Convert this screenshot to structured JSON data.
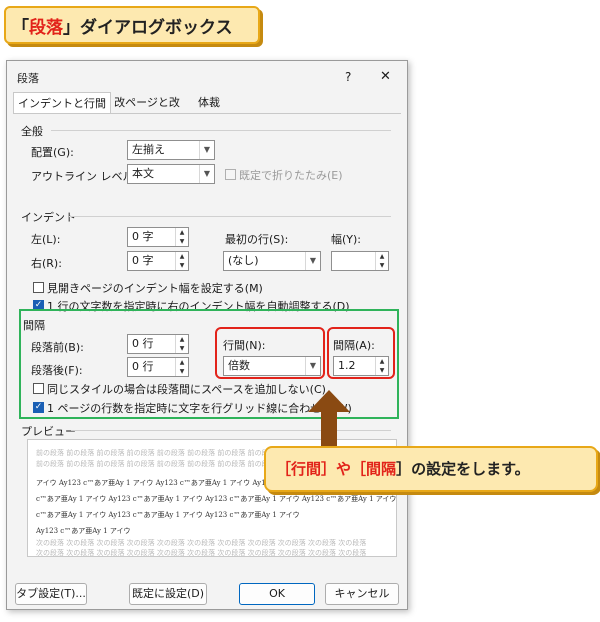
{
  "banner": {
    "prefix": "「",
    "highlight": "段落",
    "suffix": "」ダイアログボックス"
  },
  "dialog": {
    "title": "段落",
    "help": "?",
    "close": "✕",
    "tabs": [
      "インデントと行間隔",
      "改ページと改行",
      "体裁"
    ],
    "general": {
      "header": "全般",
      "alignment_label": "配置(G):",
      "alignment_value": "左揃え",
      "outline_label": "アウトライン レベル(O):",
      "outline_value": "本文",
      "collapsed_label": "既定で折りたたみ(E)"
    },
    "indent": {
      "header": "インデント",
      "left_label": "左(L):",
      "left_value": "0 字",
      "right_label": "右(R):",
      "right_value": "0 字",
      "first_line_label": "最初の行(S):",
      "first_line_value": "(なし)",
      "width_label": "幅(Y):",
      "width_value": "",
      "mirror_label": "見開きページのインデント幅を設定する(M)",
      "auto_adjust_label": "1 行の文字数を指定時に右のインデント幅を自動調整する(D)"
    },
    "spacing": {
      "header": "間隔",
      "before_label": "段落前(B):",
      "before_value": "0 行",
      "after_label": "段落後(F):",
      "after_value": "0 行",
      "line_spacing_label": "行間(N):",
      "line_spacing_value": "倍数",
      "at_label": "間隔(A):",
      "at_value": "1.2",
      "no_space_label": "同じスタイルの場合は段落間にスペースを追加しない(C)",
      "snap_grid_label": "1 ページの行数を指定時に文字を行グリッド線に合わせる(W)"
    },
    "preview": {
      "header": "プレビュー",
      "prev_para": "前の段落 前の段落 前の段落 前の段落 前の段落 前の段落 前の段落 前の段落 前の段落 前の段落 前の段落",
      "sample1": "アイウ Ay123 c™あア亜Ay 1 アイウ Ay123 c™あア亜Ay 1 アイウ Ay123 c™あア亜Ay 1 アイウ",
      "sample2": "c™あア亜Ay 1 アイウ Ay123 c™あア亜Ay 1 アイウ Ay123 c™あア亜Ay 1 アイウ Ay123 c™あア亜Ay 1 アイウ",
      "sample3": "c™あア亜Ay 1 アイウ Ay123 c™あア亜Ay 1 アイウ Ay123 c™あア亜Ay 1 アイウ",
      "sample4": "Ay123 c™あア亜Ay 1 アイウ",
      "next_para": "次の段落 次の段落 次の段落 次の段落 次の段落 次の段落 次の段落 次の段落 次の段落 次の段落 次の段落"
    },
    "buttons": {
      "tabs": "タブ設定(T)...",
      "default": "既定に設定(D)",
      "ok": "OK",
      "cancel": "キャンセル"
    }
  },
  "callout": {
    "part1": "［",
    "hl1": "行間",
    "part2": "］や［",
    "hl2": "間隔",
    "part3": "］の設定をします。"
  },
  "colors": {
    "highlight_red": "#e2231a",
    "green_frame": "#2fb35a",
    "callout_bg": "#fde9b0",
    "arrow_brown": "#8a4a12"
  }
}
